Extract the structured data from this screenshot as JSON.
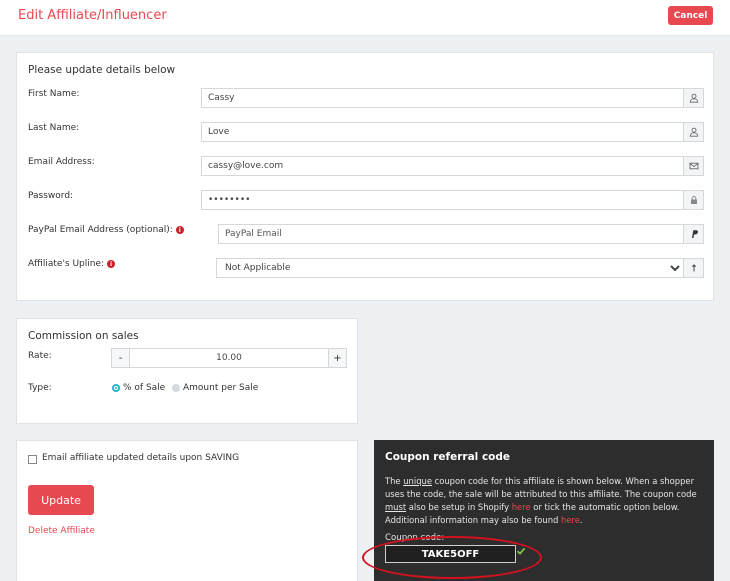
{
  "header": {
    "title": "Edit Affiliate/Influencer",
    "cancel_label": "Cancel"
  },
  "details": {
    "title": "Please update details below",
    "first_name": {
      "label": "First Name:",
      "value": "Cassy",
      "icon": "user-icon"
    },
    "last_name": {
      "label": "Last Name:",
      "value": "Love",
      "icon": "user-icon"
    },
    "email": {
      "label": "Email Address:",
      "value": "cassy@love.com",
      "icon": "envelope-icon"
    },
    "password": {
      "label": "Password:",
      "value": "••••••••",
      "icon": "lock-icon"
    },
    "paypal": {
      "label": "PayPal Email Address (optional):",
      "placeholder": "PayPal Email",
      "icon": "paypal-icon"
    },
    "upline": {
      "label": "Affiliate's Upline:",
      "value": "Not Applicable",
      "options": [
        "Not Applicable"
      ],
      "icon": "sort-icon"
    }
  },
  "commission": {
    "title": "Commission on sales",
    "rate_label": "Rate:",
    "rate_value": "10.00",
    "minus": "-",
    "plus": "+",
    "type_label": "Type:",
    "type_options": [
      "% of Sale",
      "Amount per Sale"
    ],
    "selected_type": "% of Sale"
  },
  "save_box": {
    "email_checkbox_label": "Email affiliate updated details upon SAVING",
    "update_label": "Update",
    "delete_label": "Delete Affiliate"
  },
  "coupon": {
    "title": "Coupon referral code",
    "text_1": "The ",
    "text_unique": "unique",
    "text_2": " coupon code for this affiliate is shown below. When a shopper uses the code, the sale will be attributed to this affiliate. The coupon code ",
    "text_must": "must",
    "text_3": " also be setup in Shopify ",
    "text_here1": "here",
    "text_4": " or tick the automatic option below. Additional information may also be found ",
    "text_here2": "here",
    "text_5": ".",
    "code_label": "Coupon code:",
    "code_value": "TAKE5OFF"
  },
  "colors": {
    "accent": "#e8484f",
    "radio_on": "#29b6c6",
    "dark_panel": "#2d2d2d",
    "annotation": "#d4121f",
    "check": "#7cc242"
  }
}
